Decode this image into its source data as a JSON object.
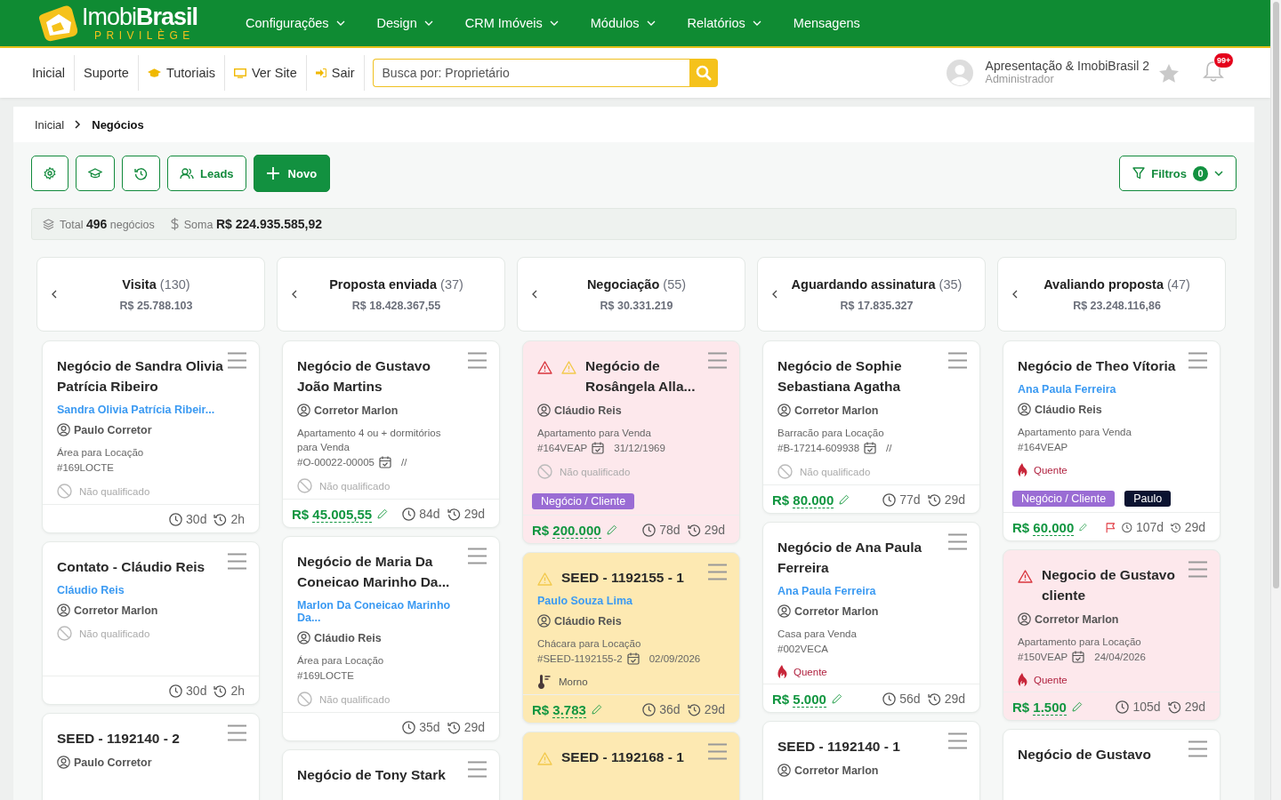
{
  "header": {
    "logo": {
      "word_light": "Imobi",
      "word_bold": "Brasil",
      "tagline": "PRIVILÈGE"
    },
    "menu": [
      {
        "label": "Configurações",
        "dropdown": true
      },
      {
        "label": "Design",
        "dropdown": true
      },
      {
        "label": "CRM Imóveis",
        "dropdown": true
      },
      {
        "label": "Módulos",
        "dropdown": true
      },
      {
        "label": "Relatórios",
        "dropdown": true
      },
      {
        "label": "Mensagens",
        "dropdown": false
      }
    ]
  },
  "toolbar": {
    "links": [
      {
        "label": "Inicial"
      },
      {
        "label": "Suporte"
      },
      {
        "label": "Tutoriais"
      },
      {
        "label": "Ver Site"
      },
      {
        "label": "Sair"
      }
    ],
    "search": {
      "placeholder": "Busca por: Proprietário"
    },
    "user": {
      "name": "Apresentação & ImobiBrasil 2",
      "role": "Administrador"
    },
    "notifications": "99+"
  },
  "breadcrumb": [
    {
      "label": "Inicial",
      "current": false
    },
    {
      "label": "Negócios",
      "current": true
    }
  ],
  "actions": [
    {
      "kind": "settings"
    },
    {
      "kind": "training"
    },
    {
      "kind": "history"
    },
    {
      "kind": "leads",
      "label": "Leads"
    },
    {
      "kind": "new",
      "label": "Novo"
    }
  ],
  "filters": {
    "label": "Filtros",
    "count": "0"
  },
  "summary": {
    "total": "Total **496** negócios",
    "sum": "Soma **R$ 224.935.585,92**"
  },
  "columns": [
    {
      "title": "Visita",
      "count": "(130)",
      "total": "R$ 25.788.103",
      "cards": [
        {
          "kind": "normal",
          "title": "Negócio de Sandra Olivia Patrícia Ribeiro",
          "contact": "Sandra Olivia Patrícia Ribeir...",
          "agent": "Paulo Corretor",
          "property": "Área para Locação",
          "code": "#169LOCTE",
          "status": {
            "kind": "unqualified",
            "label": "Não qualificado"
          },
          "flagged": false,
          "age": "30d",
          "updated": "2h"
        },
        {
          "kind": "normal",
          "title": "Contato - Cláudio Reis",
          "contact": "Cláudio Reis",
          "agent": "Corretor Marlon",
          "status": {
            "kind": "unqualified",
            "label": "Não qualificado"
          },
          "flagged": false,
          "age": "30d",
          "updated": "2h"
        },
        {
          "kind": "normal",
          "title": "SEED - 1192140 - 2",
          "agent": "Paulo Corretor"
        }
      ]
    },
    {
      "title": "Proposta enviada",
      "count": "(37)",
      "total": "R$ 18.428.367,55",
      "cards": [
        {
          "kind": "normal",
          "title": "Negócio de Gustavo João Martins",
          "agent": "Corretor Marlon",
          "property": "Apartamento 4 ou + dormitórios para Venda",
          "code": "#O-00022-00005",
          "date": "//",
          "status": {
            "kind": "unqualified",
            "label": "Não qualificado"
          },
          "currency": "R$",
          "amount": "45.005,55",
          "flagged": false,
          "age": "84d",
          "updated": "29d"
        },
        {
          "kind": "normal",
          "title": "Negócio de Maria Da Coneicao Marinho Da...",
          "contact": "Marlon Da Coneicao Marinho Da...",
          "agent": "Cláudio Reis",
          "property": "Área para Locação",
          "code": "#169LOCTE",
          "status": {
            "kind": "unqualified",
            "label": "Não qualificado"
          },
          "flagged": false,
          "age": "35d",
          "updated": "29d"
        },
        {
          "kind": "normal",
          "title": "Negócio de Tony Stark"
        }
      ]
    },
    {
      "title": "Negociação",
      "count": "(55)",
      "total": "R$ 30.331.219",
      "cards": [
        {
          "kind": "danger",
          "alerts": [
            {
              "kind": "danger"
            },
            {
              "kind": "warning"
            }
          ],
          "title": "Negócio de Rosângela Alla...",
          "agent": "Cláudio Reis",
          "property": "Apartamento para Venda",
          "code": "#164VEAP",
          "date": "31/12/1969",
          "status": {
            "kind": "unqualified",
            "label": "Não qualificado"
          },
          "tags": [
            {
              "label": "Negócio / Cliente",
              "color": "#9a6cd4"
            }
          ],
          "currency": "R$",
          "amount": "200.000",
          "flagged": false,
          "age": "78d",
          "updated": "29d"
        },
        {
          "kind": "warning",
          "alerts": [
            {
              "kind": "warning"
            }
          ],
          "title": "SEED - 1192155 - 1",
          "contact": "Paulo Souza Lima",
          "agent": "Cláudio Reis",
          "property": "Chácara para Locação",
          "code": "#SEED-1192155-2",
          "date": "02/09/2026",
          "status": {
            "kind": "warm",
            "label": "Morno"
          },
          "currency": "R$",
          "amount": "3.783",
          "flagged": false,
          "age": "36d",
          "updated": "29d"
        },
        {
          "kind": "warning",
          "alerts": [
            {
              "kind": "warning"
            }
          ],
          "title": "SEED - 1192168 - 1"
        }
      ]
    },
    {
      "title": "Aguardando assinatura",
      "count": "(35)",
      "total": "R$ 17.835.327",
      "cards": [
        {
          "kind": "normal",
          "title": "Negócio de Sophie Sebastiana Agatha",
          "agent": "Corretor Marlon",
          "property": "Barracão para Locação",
          "code": "#B-17214-609938",
          "date": "//",
          "status": {
            "kind": "unqualified",
            "label": "Não qualificado"
          },
          "currency": "R$",
          "amount": "80.000",
          "flagged": false,
          "age": "77d",
          "updated": "29d"
        },
        {
          "kind": "normal",
          "title": "Negócio de Ana Paula Ferreira",
          "contact": "Ana Paula Ferreira",
          "agent": "Corretor Marlon",
          "property": "Casa para Venda",
          "code": "#002VECA",
          "status": {
            "kind": "hot",
            "label": "Quente"
          },
          "currency": "R$",
          "amount": "5.000",
          "flagged": false,
          "age": "56d",
          "updated": "29d"
        },
        {
          "kind": "normal",
          "title": "SEED - 1192140 - 1",
          "agent": "Corretor Marlon"
        }
      ]
    },
    {
      "title": "Avaliando proposta",
      "count": "(47)",
      "total": "R$ 23.248.116,86",
      "cards": [
        {
          "kind": "normal",
          "title": "Negócio de Theo Vítoria",
          "contact": "Ana Paula Ferreira",
          "agent": "Cláudio Reis",
          "property": "Apartamento para Venda",
          "code": "#164VEAP",
          "status": {
            "kind": "hot",
            "label": "Quente"
          },
          "tags": [
            {
              "label": "Negócio / Cliente",
              "color": "#9a6cd4"
            },
            {
              "label": "Paulo",
              "color": "#0b1330"
            }
          ],
          "currency": "R$",
          "amount": "60.000",
          "flagged": true,
          "age": "107d",
          "updated": "29d"
        },
        {
          "kind": "danger",
          "alerts": [
            {
              "kind": "danger"
            }
          ],
          "title": "Negocio de Gustavo cliente",
          "agent": "Corretor Marlon",
          "property": "Apartamento para Locação",
          "code": "#150VEAP",
          "date": "24/04/2026",
          "status": {
            "kind": "hot",
            "label": "Quente"
          },
          "currency": "R$",
          "amount": "1.500",
          "flagged": false,
          "age": "105d",
          "updated": "29d"
        },
        {
          "kind": "normal",
          "title": "Negócio de Gustavo"
        }
      ]
    }
  ]
}
